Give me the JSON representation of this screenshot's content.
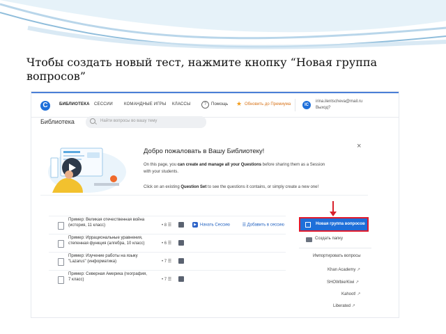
{
  "slide": {
    "heading": "Чтобы создать новый тест, нажмите кнопку “Новая группа вопросов”"
  },
  "app": {
    "nav": {
      "logo": "C",
      "library": "БИБЛИОТЕКА",
      "sessions": "СЕССИИ",
      "team_games": "КОМАНДНЫЕ ИГРЫ",
      "classes": "КЛАССЫ",
      "help": "Помощь",
      "upgrade": "Обновить до Премиума",
      "avatar_initials": "IC",
      "email": "irina.ilentscheva@mail.ru",
      "logout": "Выход?"
    },
    "library": {
      "title": "Библиотека",
      "search_placeholder": "Найти вопросы во вашу тему"
    },
    "welcome": {
      "title": "Добро пожаловать в Вашу Библиотеку!",
      "p1_a": "On this page, you ",
      "p1_b": "can create and manage all your Questions",
      "p1_c": " before sharing them as a Session",
      "p2": "with your students.",
      "p3_a": "Click on an existing ",
      "p3_b": "Question Set",
      "p3_c": " to see the questions it contains, or simply create a new one!",
      "close": "×"
    },
    "question_sets": [
      {
        "line1": "Пример: Великая отечественная война",
        "line2": "(история, 11 класс)",
        "count": "• 8 ☰",
        "start": "Начать Сессию",
        "add": "Добавить в сессию"
      },
      {
        "line1": "Пример: Иррациональные уравнения,",
        "line2": "степенная функция (алгебра, 10 класс)",
        "count": "• 6 ☰",
        "start": "",
        "add": ""
      },
      {
        "line1": "Пример: Изучение работы на языку",
        "line2": "\"Lazarus\" (информатика)",
        "count": "• 7 ☰",
        "start": "",
        "add": ""
      },
      {
        "line1": "Пример: Северная Америка (география,",
        "line2": "7 класс)",
        "count": "• 7 ☰",
        "start": "",
        "add": ""
      }
    ],
    "sidebar": {
      "new_set": "Новая группа вопросов",
      "create_folder": "Создать папку",
      "imports_title": "Импортировать вопросы",
      "imports": [
        "Khan Academy",
        "SHOWbie/Kiwi",
        "Kahoot!",
        "Liberated"
      ],
      "external_glyph": "↗"
    }
  },
  "colors": {
    "accent": "#1e6fd9",
    "highlight_red": "#e2192b",
    "upgrade_orange": "#d8741a"
  }
}
